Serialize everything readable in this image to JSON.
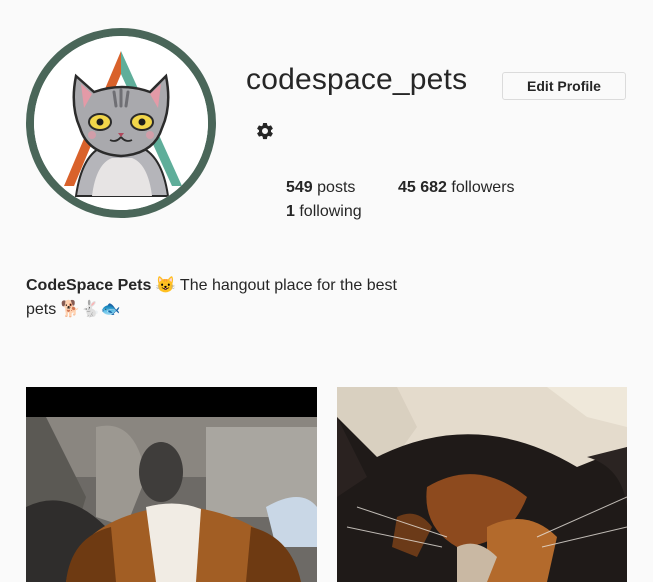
{
  "profile": {
    "username": "codespace_pets",
    "edit_label": "Edit Profile",
    "avatar_icon": "cat-avatar-icon",
    "settings_icon": "gear-icon"
  },
  "stats": {
    "posts_count": "549",
    "posts_label": "posts",
    "followers_count": "45 682",
    "followers_label": "followers",
    "following_count": "1",
    "following_label": "following"
  },
  "bio": {
    "name": "CodeSpace Pets",
    "name_emoji": "😺",
    "text": "The hangout place for the best pets",
    "emojis": "🐕🐇🐟"
  },
  "posts": [
    {
      "subject": "dog-photo"
    },
    {
      "subject": "cat-photo"
    }
  ],
  "colors": {
    "avatar_ring": "#4a6659",
    "triangle_orange": "#d9622b",
    "triangle_teal": "#5fae9a",
    "cat_grey": "#a9a9ad",
    "background": "#fafafa"
  }
}
